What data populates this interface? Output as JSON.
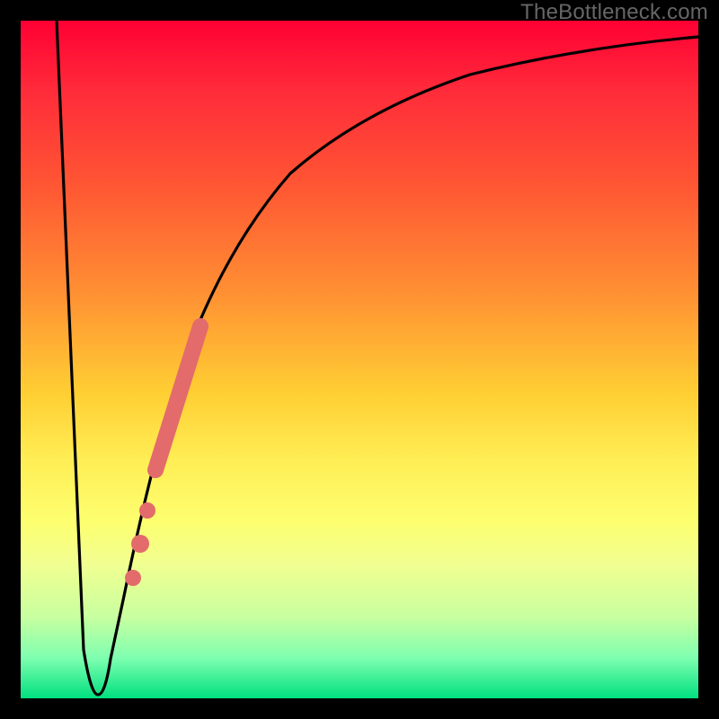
{
  "watermark": "TheBottleneck.com",
  "chart_data": {
    "type": "line",
    "title": "",
    "xlabel": "",
    "ylabel": "",
    "xlim": [
      0,
      100
    ],
    "ylim": [
      0,
      100
    ],
    "series": [
      {
        "name": "bottleneck-curve",
        "x": [
          0,
          8,
          10,
          11,
          12,
          14,
          16,
          18,
          20,
          22,
          24,
          26,
          30,
          35,
          40,
          50,
          60,
          70,
          80,
          90,
          100
        ],
        "values": [
          100,
          6,
          1,
          0.5,
          1,
          6,
          14,
          24,
          33,
          41,
          48,
          54,
          64,
          73,
          79,
          86,
          90,
          93,
          95,
          96.5,
          97.5
        ]
      }
    ],
    "markers": [
      {
        "name": "highlight-segment",
        "type": "segment",
        "x0": 20,
        "y0": 33,
        "x1": 26,
        "y1": 54
      },
      {
        "name": "dot-1",
        "type": "dot",
        "x": 18.5,
        "y": 27
      },
      {
        "name": "dot-2",
        "type": "dot",
        "x": 17.5,
        "y": 22
      },
      {
        "name": "dot-3",
        "type": "dot",
        "x": 16.5,
        "y": 17
      }
    ],
    "colors": {
      "curve": "#000000",
      "marker": "#e36b6b",
      "gradient_top": "#ff0033",
      "gradient_bottom": "#00e07f"
    }
  }
}
